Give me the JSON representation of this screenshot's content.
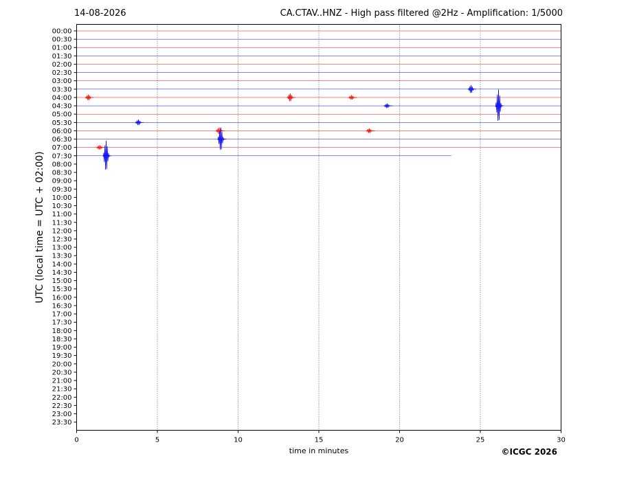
{
  "header": {
    "date": "14-08-2026",
    "title": "CA.CTAV..HNZ - High pass filtered @2Hz - Amplification: 1/5000"
  },
  "copyright": "©ICGC 2026",
  "chart_data": {
    "type": "line",
    "title": "CA.CTAV..HNZ - High pass filtered @2Hz - Amplification: 1/5000",
    "xlabel": "time in minutes",
    "ylabel": "UTC (local time = UTC + 02:00)",
    "xlim": [
      0,
      30
    ],
    "xticks": [
      0,
      5,
      10,
      15,
      20,
      25,
      30
    ],
    "grid": "vertical dotted lines at x ticks",
    "row_labels": [
      "00:00",
      "00:30",
      "01:00",
      "01:30",
      "02:00",
      "02:30",
      "03:00",
      "03:30",
      "04:00",
      "04:30",
      "05:00",
      "05:30",
      "06:00",
      "06:30",
      "07:00",
      "07:30",
      "08:00",
      "08:30",
      "09:00",
      "09:30",
      "10:00",
      "10:30",
      "11:00",
      "11:30",
      "12:00",
      "12:30",
      "13:00",
      "13:30",
      "14:00",
      "14:30",
      "15:00",
      "15:30",
      "16:00",
      "16:30",
      "17:00",
      "17:30",
      "18:00",
      "18:30",
      "19:00",
      "19:30",
      "20:00",
      "20:30",
      "21:00",
      "21:30",
      "22:00",
      "22:30",
      "23:00",
      "23:30"
    ],
    "trace_colors": [
      "#ff0000",
      "#0000ff"
    ],
    "last_trace_row": "07:30",
    "last_trace_end_minute": 23.2,
    "events": [
      {
        "row": "03:30",
        "minute": 24.5,
        "amplitude": 0.35
      },
      {
        "row": "04:00",
        "minute": 0.8,
        "amplitude": 0.25
      },
      {
        "row": "04:00",
        "minute": 13.3,
        "amplitude": 0.35
      },
      {
        "row": "04:00",
        "minute": 17.1,
        "amplitude": 0.2
      },
      {
        "row": "04:30",
        "minute": 26.2,
        "amplitude": 1.4
      },
      {
        "row": "04:30",
        "minute": 19.3,
        "amplitude": 0.2
      },
      {
        "row": "05:30",
        "minute": 3.9,
        "amplitude": 0.25
      },
      {
        "row": "06:00",
        "minute": 8.9,
        "amplitude": 0.3
      },
      {
        "row": "06:00",
        "minute": 18.2,
        "amplitude": 0.2
      },
      {
        "row": "06:30",
        "minute": 9.0,
        "amplitude": 1.0
      },
      {
        "row": "07:00",
        "minute": 1.5,
        "amplitude": 0.2
      },
      {
        "row": "07:30",
        "minute": 1.9,
        "amplitude": 1.3
      }
    ]
  }
}
